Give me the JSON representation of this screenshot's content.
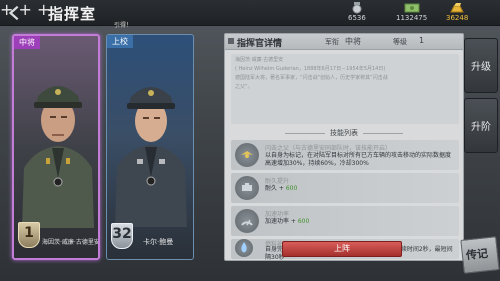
{
  "topbar": {
    "title": "指挥室",
    "note": "引得！",
    "resources": [
      {
        "icon": "medal-icon",
        "value": "6536"
      },
      {
        "icon": "banknote-icon",
        "value": "1132475"
      },
      {
        "icon": "gold-bar-icon",
        "value": "36248"
      }
    ]
  },
  "cards": [
    {
      "rank": "中将",
      "level": "1",
      "name": "海因茨·威廉·古德里安"
    },
    {
      "rank": "上校",
      "level": "32",
      "name": "卡尔·鲍曼"
    }
  ],
  "panel": {
    "title": "指挥官详情",
    "rank_label": "军衔",
    "rank_value": "中将",
    "level_label": "等级",
    "level_value": "1",
    "bio": [
      "海因茨·威廉·古德里安",
      "( Heinz Wilhelm Guderian，1888年6月17日－1954年5月14日)",
      "德国陆军大将，著名军事家，“闪击战”创始人，历史学家称其“闪击战",
      "之父”。"
    ],
    "skills_title": "技能列表",
    "skills": [
      {
        "icon": "wings-icon",
        "name": "闪击之父（与古德里安同部队时，该技能开启）",
        "desc": "以自身为标记，在对陆军目标对所有已方车辆的攻击移动的实际数据度高速增加30%，持续60%，冷却300%",
        "highlight": ""
      },
      {
        "icon": "armor-icon",
        "name": "耐久提升",
        "desc": "耐久 + ",
        "highlight": "600"
      },
      {
        "icon": "speed-icon",
        "name": "加速功率",
        "desc": "加速功率 + ",
        "highlight": "600"
      },
      {
        "icon": "flame-icon",
        "name": "燃料补给",
        "desc": "自身完成一次击毁后可提升自身最大速度5公里，持续时间2秒，最短间隔30秒",
        "highlight": ""
      }
    ],
    "deploy_label": "上阵"
  },
  "side": {
    "upgrade_label": "升级",
    "promote_label": "升阶",
    "legend_label": "传记"
  }
}
